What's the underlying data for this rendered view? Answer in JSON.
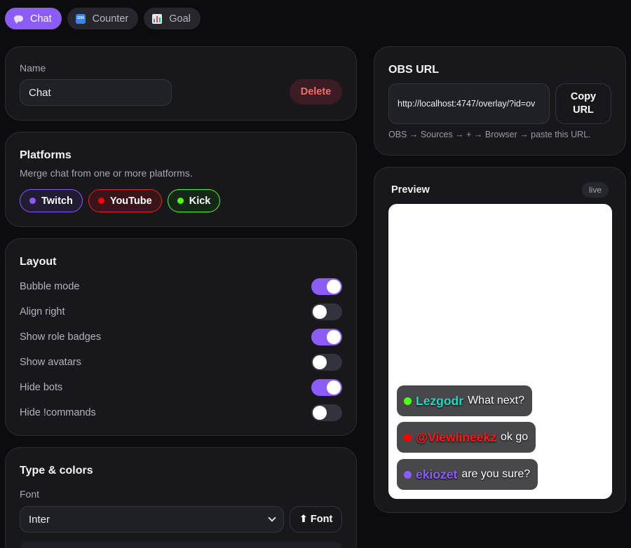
{
  "tabs": [
    {
      "label": "Chat",
      "icon": "chat-bubble-icon",
      "active": true
    },
    {
      "label": "Counter",
      "icon": "counter-icon",
      "active": false
    },
    {
      "label": "Goal",
      "icon": "bar-chart-icon",
      "active": false
    }
  ],
  "counter_icon_text": "1234",
  "name_card": {
    "label": "Name",
    "value": "Chat",
    "delete_label": "Delete"
  },
  "platforms": {
    "title": "Platforms",
    "subtitle": "Merge chat from one or more platforms.",
    "items": [
      {
        "label": "Twitch",
        "color": "#8b5cf6"
      },
      {
        "label": "YouTube",
        "color": "#ff0000"
      },
      {
        "label": "Kick",
        "color": "#53fc18"
      }
    ]
  },
  "layout": {
    "title": "Layout",
    "options": [
      {
        "label": "Bubble mode",
        "on": true
      },
      {
        "label": "Align right",
        "on": false
      },
      {
        "label": "Show role badges",
        "on": true
      },
      {
        "label": "Show avatars",
        "on": false
      },
      {
        "label": "Hide bots",
        "on": true
      },
      {
        "label": "Hide !commands",
        "on": false
      }
    ]
  },
  "type_colors": {
    "title": "Type & colors",
    "font_label": "Font",
    "font_value": "Inter",
    "upload_font_label": "⬆ Font"
  },
  "obs": {
    "title": "OBS URL",
    "url": "http://localhost:4747/overlay/?id=ov",
    "copy_label": "Copy URL",
    "hint": "OBS → Sources → + → Browser → paste this URL."
  },
  "preview": {
    "title": "Preview",
    "badge": "live",
    "messages": [
      {
        "user": "Lezgodr",
        "text": "What next?",
        "user_color": "#2dd4bf",
        "dot_color": "#53fc18"
      },
      {
        "user": "@Viewlineekz",
        "text": "ok go",
        "user_color": "#ff1a1a",
        "dot_color": "#ff0000"
      },
      {
        "user": "ekiozet",
        "text": "are you sure?",
        "user_color": "#8b5cf6",
        "dot_color": "#8b5cf6"
      }
    ]
  },
  "colors": {
    "accent": "#8b5cf6",
    "background": "#0c0c0e",
    "card": "#17171c"
  }
}
